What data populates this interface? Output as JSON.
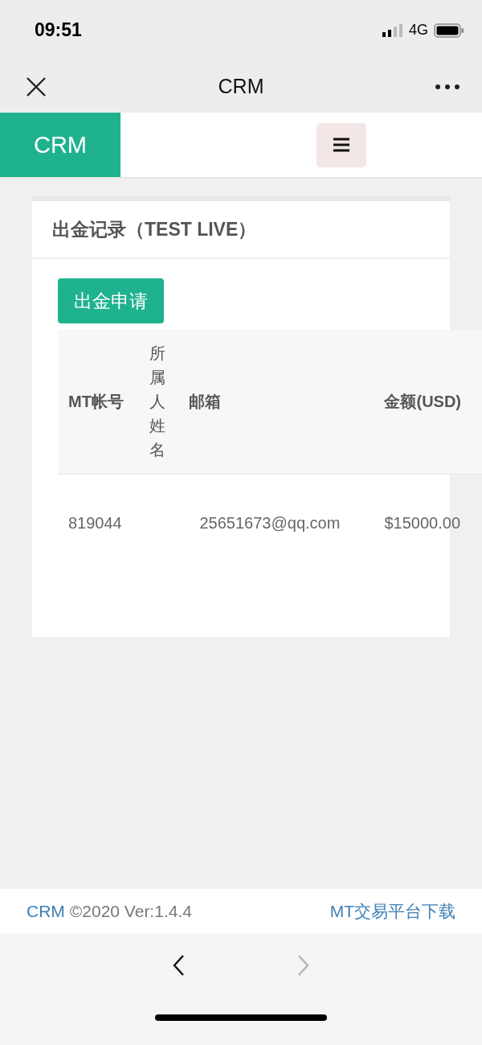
{
  "status_bar": {
    "time": "09:51",
    "network": "4G"
  },
  "browser_bar": {
    "title": "CRM"
  },
  "header": {
    "brand": "CRM"
  },
  "card": {
    "title": "出金记录（TEST LIVE）",
    "action_button": "出金申请",
    "table": {
      "columns": [
        "MT帐号",
        "所属人姓名",
        "邮箱",
        "金额(USD)"
      ],
      "rows": [
        {
          "account": "819044",
          "name": "",
          "email": "25651673@qq.com",
          "amount": "$15000.00"
        }
      ]
    }
  },
  "footer": {
    "brand_link": "CRM",
    "copyright": "©2020 Ver:1.4.4",
    "download_link": "MT交易平台下载"
  },
  "bottom_nav": [
    {
      "kind": "back",
      "disabled": false
    },
    {
      "kind": "forward",
      "disabled": true
    }
  ]
}
